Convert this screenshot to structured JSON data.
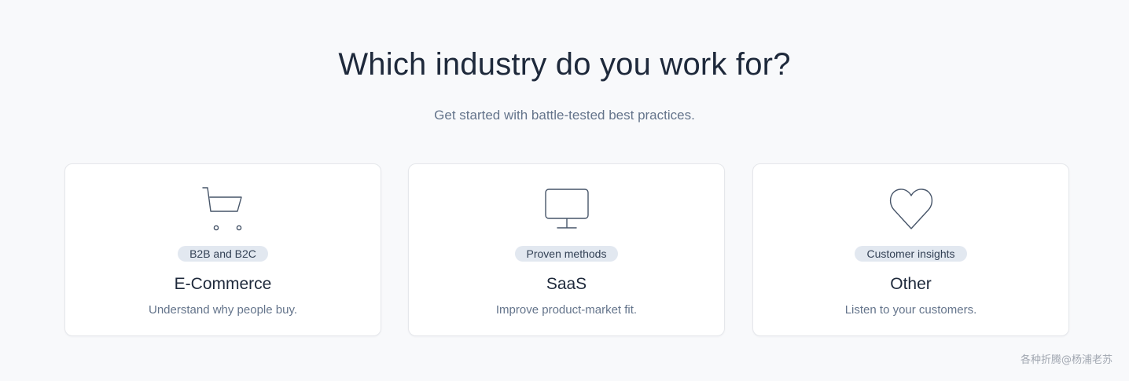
{
  "header": {
    "title": "Which industry do you work for?",
    "subtitle": "Get started with battle-tested best practices."
  },
  "cards": [
    {
      "icon": "shopping-cart-icon",
      "badge": "B2B and B2C",
      "title": "E-Commerce",
      "description": "Understand why people buy."
    },
    {
      "icon": "monitor-icon",
      "badge": "Proven methods",
      "title": "SaaS",
      "description": "Improve product-market fit."
    },
    {
      "icon": "heart-icon",
      "badge": "Customer insights",
      "title": "Other",
      "description": "Listen to your customers."
    }
  ],
  "watermark": "各种折腾@杨浦老苏",
  "colors": {
    "background": "#f8f9fb",
    "heading": "#1e293b",
    "muted": "#64748b",
    "badge_bg": "#e2e8f0",
    "icon_stroke": "#475569"
  }
}
